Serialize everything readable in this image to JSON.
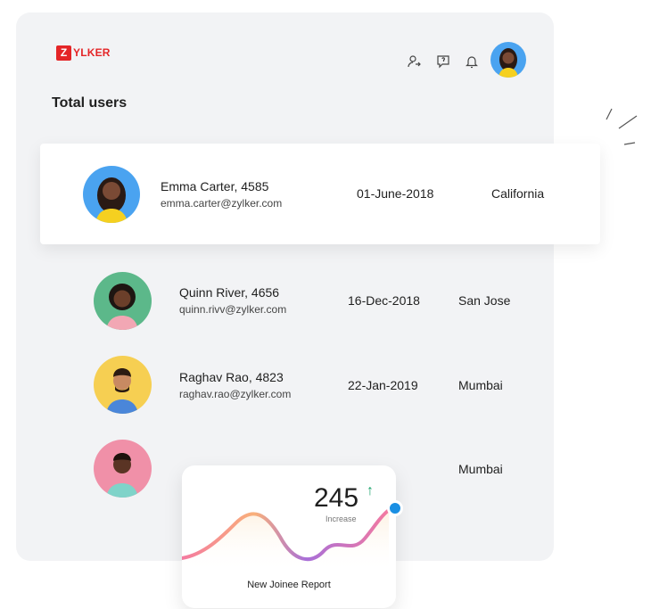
{
  "brand": {
    "logo_letter": "Z",
    "logo_text": "YLKER",
    "color": "#e42527"
  },
  "header": {
    "icons": [
      "user-share-icon",
      "chat-icon",
      "bell-icon"
    ],
    "avatar_name": "profile-avatar"
  },
  "page": {
    "title": "Total users"
  },
  "users": [
    {
      "name": "Emma Carter, 4585",
      "email": "emma.carter@zylker.com",
      "date": "01-June-2018",
      "city": "California",
      "avatar_color": "#4aa3f0"
    },
    {
      "name": "Quinn River, 4656",
      "email": "quinn.rivv@zylker.com",
      "date": "16-Dec-2018",
      "city": "San Jose",
      "avatar_color": "#5cb88a"
    },
    {
      "name": "Raghav Rao, 4823",
      "email": "raghav.rao@zylker.com",
      "date": "22-Jan-2019",
      "city": "Mumbai",
      "avatar_color": "#f6cf52"
    },
    {
      "name": "",
      "email": "",
      "date": "",
      "city": "Mumbai",
      "avatar_color": "#f090a8"
    }
  ],
  "report": {
    "value": "245",
    "arrow": "↑",
    "sub_label": "Increase",
    "title": "New Joinee Report"
  },
  "colors": {
    "panel": "#f2f3f5",
    "accent_blue": "#1a8fe3",
    "up_green": "#1aa36b"
  }
}
